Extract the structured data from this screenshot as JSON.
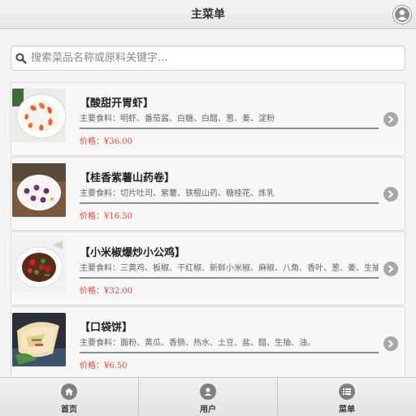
{
  "header": {
    "title": "主菜单",
    "user_icon": "user-circle-icon"
  },
  "search": {
    "placeholder": "搜索菜品名称或原料关键字...",
    "icon": "search-icon"
  },
  "dishes": [
    {
      "name": "【酸甜开胃虾】",
      "ingredients": "主要食料：明虾、番茄酱、白糖、白醋、葱、姜、淀粉",
      "price": "价格：¥36.00"
    },
    {
      "name": "【桂香紫薯山药卷】",
      "ingredients": "主要食料：切片吐司、紫薯、铁棍山药、糖桂花、炼乳",
      "price": "价格：¥16.50"
    },
    {
      "name": "【小米椒爆炒小公鸡】",
      "ingredients": "主要食料：三黄鸡、板椒、干红椒、新鲜小米椒、麻椒、八角、香叶、葱、姜、生抽",
      "price": "价格：¥32.00"
    },
    {
      "name": "【口袋饼】",
      "ingredients": "主要食料：面粉、黄瓜、香肠、热水、土豆、盐、醋、生抽、油。",
      "price": "价格：¥6.50"
    }
  ],
  "tabs": [
    {
      "label": "首页",
      "icon": "home-icon"
    },
    {
      "label": "用户",
      "icon": "user-icon"
    },
    {
      "label": "菜单",
      "icon": "menu-list-icon"
    }
  ],
  "colors": {
    "price": "#e2443a",
    "divider": "#8e8e8e",
    "icon_gray": "#7f7f7f"
  }
}
